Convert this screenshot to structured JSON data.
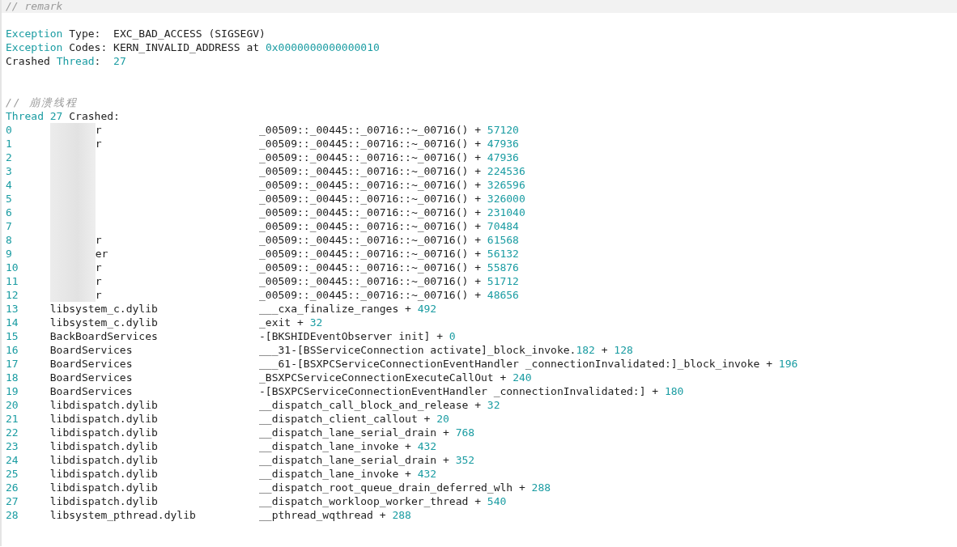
{
  "remark_comment": "// remark",
  "header_lines": [
    [
      {
        "text": "Exception",
        "kind": "keyword"
      },
      {
        "text": " Type:  EXC_BAD_ACCESS (SIGSEGV)",
        "kind": "plain"
      }
    ],
    [
      {
        "text": "Exception",
        "kind": "keyword"
      },
      {
        "text": " Codes: KERN_INVALID_ADDRESS at ",
        "kind": "plain"
      },
      {
        "text": "0x0000000000000010",
        "kind": "number"
      }
    ],
    [
      {
        "text": "Crashed ",
        "kind": "plain"
      },
      {
        "text": "Thread",
        "kind": "keyword"
      },
      {
        "text": ":  ",
        "kind": "plain"
      },
      {
        "text": "27",
        "kind": "number"
      }
    ]
  ],
  "thread_comment": "// 崩溃线程",
  "thread_header": [
    {
      "text": "Thread",
      "kind": "keyword"
    },
    {
      "text": " 27",
      "kind": "number"
    },
    {
      "text": " Crashed:",
      "kind": "plain"
    }
  ],
  "frames": [
    {
      "index": "0",
      "redacted": true,
      "library": "r",
      "symbol": [
        {
          "text": "_00509::_00445::_00716::~_00716() + ",
          "kind": "plain"
        },
        {
          "text": "57120",
          "kind": "number"
        }
      ]
    },
    {
      "index": "1",
      "redacted": true,
      "library": "r",
      "symbol": [
        {
          "text": "_00509::_00445::_00716::~_00716() + ",
          "kind": "plain"
        },
        {
          "text": "47936",
          "kind": "number"
        }
      ]
    },
    {
      "index": "2",
      "redacted": true,
      "symbol": [
        {
          "text": "_00509::_00445::_00716::~_00716() + ",
          "kind": "plain"
        },
        {
          "text": "47936",
          "kind": "number"
        }
      ]
    },
    {
      "index": "3",
      "redacted": true,
      "symbol": [
        {
          "text": "_00509::_00445::_00716::~_00716() + ",
          "kind": "plain"
        },
        {
          "text": "224536",
          "kind": "number"
        }
      ]
    },
    {
      "index": "4",
      "redacted": true,
      "symbol": [
        {
          "text": "_00509::_00445::_00716::~_00716() + ",
          "kind": "plain"
        },
        {
          "text": "326596",
          "kind": "number"
        }
      ]
    },
    {
      "index": "5",
      "redacted": true,
      "symbol": [
        {
          "text": "_00509::_00445::_00716::~_00716() + ",
          "kind": "plain"
        },
        {
          "text": "326000",
          "kind": "number"
        }
      ]
    },
    {
      "index": "6",
      "redacted": true,
      "symbol": [
        {
          "text": "_00509::_00445::_00716::~_00716() + ",
          "kind": "plain"
        },
        {
          "text": "231040",
          "kind": "number"
        }
      ]
    },
    {
      "index": "7",
      "redacted": true,
      "symbol": [
        {
          "text": "_00509::_00445::_00716::~_00716() + ",
          "kind": "plain"
        },
        {
          "text": "70484",
          "kind": "number"
        }
      ]
    },
    {
      "index": "8",
      "redacted": true,
      "library": "r",
      "symbol": [
        {
          "text": "_00509::_00445::_00716::~_00716() + ",
          "kind": "plain"
        },
        {
          "text": "61568",
          "kind": "number"
        }
      ]
    },
    {
      "index": "9",
      "redacted": true,
      "library": "er",
      "symbol": [
        {
          "text": "_00509::_00445::_00716::~_00716() + ",
          "kind": "plain"
        },
        {
          "text": "56132",
          "kind": "number"
        }
      ]
    },
    {
      "index": "10",
      "redacted": true,
      "library": "r",
      "symbol": [
        {
          "text": "_00509::_00445::_00716::~_00716() + ",
          "kind": "plain"
        },
        {
          "text": "55876",
          "kind": "number"
        }
      ]
    },
    {
      "index": "11",
      "redacted": true,
      "library": "r",
      "symbol": [
        {
          "text": "_00509::_00445::_00716::~_00716() + ",
          "kind": "plain"
        },
        {
          "text": "51712",
          "kind": "number"
        }
      ]
    },
    {
      "index": "12",
      "redacted": true,
      "library": "r",
      "symbol": [
        {
          "text": "_00509::_00445::_00716::~_00716() + ",
          "kind": "plain"
        },
        {
          "text": "48656",
          "kind": "number"
        }
      ]
    },
    {
      "index": "13",
      "redacted": false,
      "library": "libsystem_c.dylib",
      "symbol": [
        {
          "text": "___cxa_finalize_ranges + ",
          "kind": "plain"
        },
        {
          "text": "492",
          "kind": "number"
        }
      ]
    },
    {
      "index": "14",
      "redacted": false,
      "library": "libsystem_c.dylib",
      "symbol": [
        {
          "text": "_exit + ",
          "kind": "plain"
        },
        {
          "text": "32",
          "kind": "number"
        }
      ]
    },
    {
      "index": "15",
      "redacted": false,
      "library": "BackBoardServices",
      "symbol": [
        {
          "text": "-[BKSHIDEventObserver init] + ",
          "kind": "plain"
        },
        {
          "text": "0",
          "kind": "number"
        }
      ]
    },
    {
      "index": "16",
      "redacted": false,
      "library": "BoardServices",
      "symbol": [
        {
          "text": "___31-[BSServiceConnection activate]_block_invoke.",
          "kind": "plain"
        },
        {
          "text": "182",
          "kind": "number"
        },
        {
          "text": " + ",
          "kind": "plain"
        },
        {
          "text": "128",
          "kind": "number"
        }
      ]
    },
    {
      "index": "17",
      "redacted": false,
      "library": "BoardServices",
      "symbol": [
        {
          "text": "___61-[BSXPCServiceConnectionEventHandler _connectionInvalidated:]_block_invoke + ",
          "kind": "plain"
        },
        {
          "text": "196",
          "kind": "number"
        }
      ]
    },
    {
      "index": "18",
      "redacted": false,
      "library": "BoardServices",
      "symbol": [
        {
          "text": "_BSXPCServiceConnectionExecuteCallOut + ",
          "kind": "plain"
        },
        {
          "text": "240",
          "kind": "number"
        }
      ]
    },
    {
      "index": "19",
      "redacted": false,
      "library": "BoardServices",
      "symbol": [
        {
          "text": "-[BSXPCServiceConnectionEventHandler _connectionInvalidated:] + ",
          "kind": "plain"
        },
        {
          "text": "180",
          "kind": "number"
        }
      ]
    },
    {
      "index": "20",
      "redacted": false,
      "library": "libdispatch.dylib",
      "symbol": [
        {
          "text": "__dispatch_call_block_and_release + ",
          "kind": "plain"
        },
        {
          "text": "32",
          "kind": "number"
        }
      ]
    },
    {
      "index": "21",
      "redacted": false,
      "library": "libdispatch.dylib",
      "symbol": [
        {
          "text": "__dispatch_client_callout + ",
          "kind": "plain"
        },
        {
          "text": "20",
          "kind": "number"
        }
      ]
    },
    {
      "index": "22",
      "redacted": false,
      "library": "libdispatch.dylib",
      "symbol": [
        {
          "text": "__dispatch_lane_serial_drain + ",
          "kind": "plain"
        },
        {
          "text": "768",
          "kind": "number"
        }
      ]
    },
    {
      "index": "23",
      "redacted": false,
      "library": "libdispatch.dylib",
      "symbol": [
        {
          "text": "__dispatch_lane_invoke + ",
          "kind": "plain"
        },
        {
          "text": "432",
          "kind": "number"
        }
      ]
    },
    {
      "index": "24",
      "redacted": false,
      "library": "libdispatch.dylib",
      "symbol": [
        {
          "text": "__dispatch_lane_serial_drain + ",
          "kind": "plain"
        },
        {
          "text": "352",
          "kind": "number"
        }
      ]
    },
    {
      "index": "25",
      "redacted": false,
      "library": "libdispatch.dylib",
      "symbol": [
        {
          "text": "__dispatch_lane_invoke + ",
          "kind": "plain"
        },
        {
          "text": "432",
          "kind": "number"
        }
      ]
    },
    {
      "index": "26",
      "redacted": false,
      "library": "libdispatch.dylib",
      "symbol": [
        {
          "text": "__dispatch_root_queue_drain_deferred_wlh + ",
          "kind": "plain"
        },
        {
          "text": "288",
          "kind": "number"
        }
      ]
    },
    {
      "index": "27",
      "redacted": false,
      "library": "libdispatch.dylib",
      "symbol": [
        {
          "text": "__dispatch_workloop_worker_thread + ",
          "kind": "plain"
        },
        {
          "text": "540",
          "kind": "number"
        }
      ]
    },
    {
      "index": "28",
      "redacted": false,
      "library": "libsystem_pthread.dylib",
      "symbol": [
        {
          "text": "__pthread_wqthread + ",
          "kind": "plain"
        },
        {
          "text": "288",
          "kind": "number"
        }
      ]
    }
  ]
}
